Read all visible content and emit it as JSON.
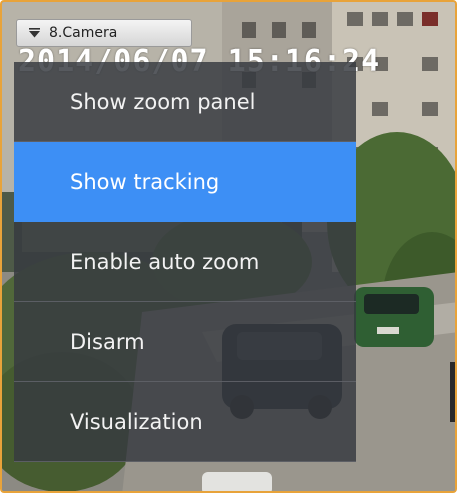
{
  "camera_button": {
    "label": "8.Camera",
    "icon": "dropdown-arrow-icon"
  },
  "overlay": {
    "timestamp": "2014/06/07 15:16:24"
  },
  "menu": {
    "items": [
      {
        "label": "Show zoom panel",
        "selected": false
      },
      {
        "label": "Show tracking",
        "selected": true
      },
      {
        "label": "Enable auto zoom",
        "selected": false
      },
      {
        "label": "Disarm",
        "selected": false
      },
      {
        "label": "Visualization",
        "selected": false
      }
    ],
    "selected_color": "#3d8ff5"
  },
  "colors": {
    "frame_border": "#e8a33a",
    "menu_background": "#373a40"
  }
}
